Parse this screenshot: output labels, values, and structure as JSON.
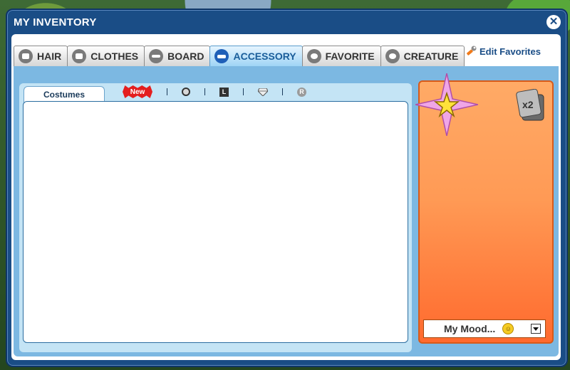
{
  "window": {
    "title": "MY INVENTORY",
    "close_label": "✕"
  },
  "tabs": [
    {
      "label": "HAIR",
      "icon": "hair-icon",
      "active": false
    },
    {
      "label": "CLOTHES",
      "icon": "shirt-icon",
      "active": false
    },
    {
      "label": "BOARD",
      "icon": "board-icon",
      "active": false
    },
    {
      "label": "ACCESSORY",
      "icon": "glasses-icon",
      "active": true
    },
    {
      "label": "FAVORITE",
      "icon": "heart-icon",
      "active": false
    },
    {
      "label": "CREATURE",
      "icon": "creature-icon",
      "active": false
    }
  ],
  "edit_favorites": {
    "label": "Edit Favorites",
    "icon": "wrench-icon"
  },
  "subtabs": {
    "active": "Costumes"
  },
  "filters": {
    "new_label": "New",
    "l_label": "L",
    "r_label": "R"
  },
  "character_panel": {
    "multiplier": "x2"
  },
  "mood": {
    "label": "My Mood...",
    "icon": "smiley-icon"
  },
  "colors": {
    "window": "#1a4d86",
    "accent": "#7cb8e2",
    "panel": "#ff9a55",
    "active_tab": "#1a5d9a"
  }
}
